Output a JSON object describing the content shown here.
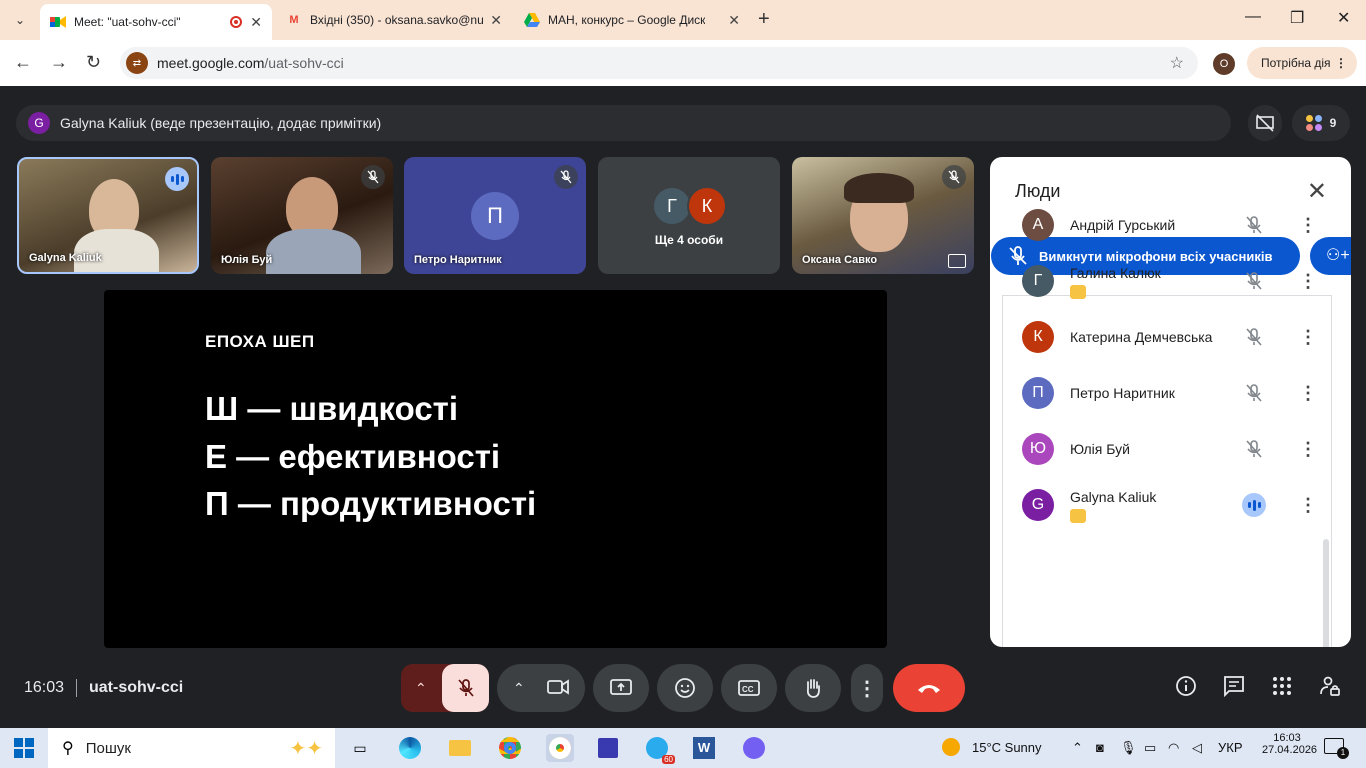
{
  "browser": {
    "tabs": [
      {
        "title": "Meet: \"uat-sohv-cci\"",
        "icon": "google-meet-icon",
        "active": true
      },
      {
        "title": "Вхідні (350) - oksana.savko@nu",
        "icon": "gmail-icon",
        "active": false
      },
      {
        "title": "МАН, конкурс – Google Диск",
        "icon": "google-drive-icon",
        "active": false
      }
    ],
    "url_host": "meet.google.com",
    "url_path": "/uat-sohv-cci",
    "profile_initial": "O",
    "action_label": "Потрібна дія"
  },
  "meet": {
    "presenter_text": "Galyna Kaliuk (веде презентацію, додає примітки)",
    "presenter_initial": "G",
    "participant_count": "9",
    "tiles": [
      {
        "name": "Galyna Kaliuk",
        "state": "speaking"
      },
      {
        "name": "Юлія Буй",
        "state": "muted"
      },
      {
        "name": "Петро Наритник",
        "initial": "П",
        "state": "muted"
      },
      {
        "name": "Ще 4 особи",
        "initials": [
          "Г",
          "К"
        ]
      },
      {
        "name": "Оксана Савко",
        "state": "muted"
      }
    ],
    "slide": {
      "kicker": "ЕПОХА ШЕП",
      "lines": [
        "Ш — швидкості",
        "Е — ефективності",
        "П — продуктивності"
      ]
    },
    "people_panel": {
      "title": "Люди",
      "mute_all_label": "Вимкнути мікрофони всіх учасників",
      "participants": [
        {
          "initial": "А",
          "name": "Андрій Гурський",
          "color": "#6d4c41",
          "presenting": false,
          "speaking": false
        },
        {
          "initial": "Г",
          "name": "Галина Калюк",
          "color": "#455a64",
          "presenting": true,
          "speaking": false
        },
        {
          "initial": "К",
          "name": "Катерина Демчевська",
          "color": "#bf360c",
          "presenting": false,
          "speaking": false
        },
        {
          "initial": "П",
          "name": "Петро Наритник",
          "color": "#5c6bc0",
          "presenting": false,
          "speaking": false
        },
        {
          "initial": "Ю",
          "name": "Юлія Буй",
          "color": "#ab47bc",
          "presenting": false,
          "speaking": false
        },
        {
          "initial": "G",
          "name": "Galyna Kaliuk",
          "color": "#7b1fa2",
          "presenting": true,
          "speaking": true
        }
      ]
    },
    "footer": {
      "time": "16:03",
      "meeting_code": "uat-sohv-cci"
    }
  },
  "taskbar": {
    "search_label": "Пошук",
    "weather": "15°C  Sunny",
    "language": "УКР",
    "time": "16:03",
    "date": "27.04.2026",
    "notification_count": "1",
    "telegram_badge": "60"
  },
  "colors": {
    "accent": "#0b57d0",
    "end_call": "#ea4335",
    "mic_off": "#f9dedc",
    "background": "#202124"
  }
}
